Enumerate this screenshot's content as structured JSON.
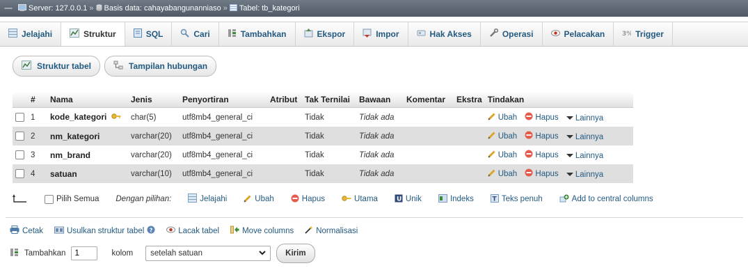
{
  "breadcrumb": {
    "server": "Server: 127.0.0.1",
    "database": "Basis data: cahayabangunanniaso",
    "table": "Tabel: tb_kategori",
    "separator": "»"
  },
  "tabs": [
    {
      "label": "Jelajahi",
      "icon": "browse-icon",
      "active": false
    },
    {
      "label": "Struktur",
      "icon": "structure-icon",
      "active": true
    },
    {
      "label": "SQL",
      "icon": "sql-icon",
      "active": false
    },
    {
      "label": "Cari",
      "icon": "search-icon",
      "active": false
    },
    {
      "label": "Tambahkan",
      "icon": "insert-icon",
      "active": false
    },
    {
      "label": "Ekspor",
      "icon": "export-icon",
      "active": false
    },
    {
      "label": "Impor",
      "icon": "import-icon",
      "active": false
    },
    {
      "label": "Hak Akses",
      "icon": "privileges-icon",
      "active": false
    },
    {
      "label": "Operasi",
      "icon": "wrench-icon",
      "active": false
    },
    {
      "label": "Pelacakan",
      "icon": "tracking-icon",
      "active": false
    },
    {
      "label": "Trigger",
      "icon": "trigger-icon",
      "active": false
    }
  ],
  "subtabs": {
    "structure": "Struktur tabel",
    "relations": "Tampilan hubungan"
  },
  "table": {
    "headers": [
      "#",
      "Nama",
      "Jenis",
      "Penyortiran",
      "Atribut",
      "Tak Ternilai",
      "Bawaan",
      "Komentar",
      "Ekstra",
      "Tindakan"
    ],
    "rows": [
      {
        "num": "1",
        "name": "kode_kategori",
        "type": "char(5)",
        "collation": "utf8mb4_general_ci",
        "attr": "",
        "null": "Tidak",
        "default": "Tidak ada",
        "comment": "",
        "extra": "",
        "primary": true
      },
      {
        "num": "2",
        "name": "nm_kategori",
        "type": "varchar(20)",
        "collation": "utf8mb4_general_ci",
        "attr": "",
        "null": "Tidak",
        "default": "Tidak ada",
        "comment": "",
        "extra": "",
        "primary": false
      },
      {
        "num": "3",
        "name": "nm_brand",
        "type": "varchar(20)",
        "collation": "utf8mb4_general_ci",
        "attr": "",
        "null": "Tidak",
        "default": "Tidak ada",
        "comment": "",
        "extra": "",
        "primary": false
      },
      {
        "num": "4",
        "name": "satuan",
        "type": "varchar(10)",
        "collation": "utf8mb4_general_ci",
        "attr": "",
        "null": "Tidak",
        "default": "Tidak ada",
        "comment": "",
        "extra": "",
        "primary": false
      }
    ],
    "actions": {
      "change": "Ubah",
      "drop": "Hapus",
      "more": "Lainnya"
    }
  },
  "bulk": {
    "select_all": "Pilih Semua",
    "with_selected": "Dengan pilihan:",
    "browse": "Jelajahi",
    "change": "Ubah",
    "drop": "Hapus",
    "primary": "Utama",
    "unique": "Unik",
    "index": "Indeks",
    "fulltext": "Teks penuh",
    "central": "Add to central columns"
  },
  "tools": {
    "print": "Cetak",
    "propose": "Usulkan struktur tabel",
    "track": "Lacak tabel",
    "move": "Move columns",
    "normalize": "Normalisasi"
  },
  "add_column": {
    "label": "Tambahkan",
    "count": "1",
    "unit": "kolom",
    "position": "setelah satuan",
    "submit": "Kirim"
  },
  "colors": {
    "link": "#235a81",
    "row_alt": "#dfdfdf",
    "breadcrumb_bg": "#5f6a76"
  }
}
